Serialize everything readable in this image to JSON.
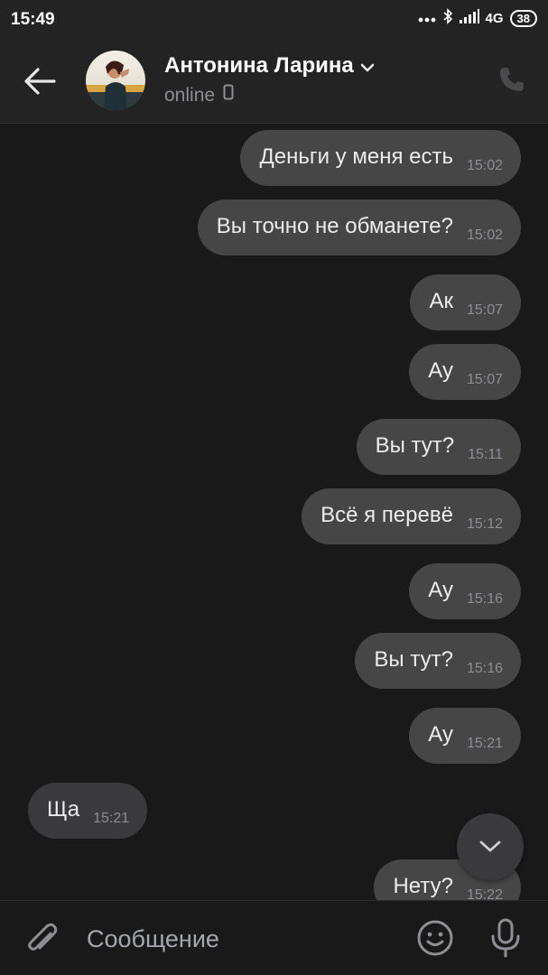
{
  "status_bar": {
    "time": "15:49",
    "network": "4G",
    "battery": "38"
  },
  "header": {
    "contact_name": "Антонина Ларина",
    "status": "online"
  },
  "messages": [
    {
      "text": "Деньги у меня есть",
      "time": "15:02",
      "direction": "out"
    },
    {
      "text": "Вы точно не обманете?",
      "time": "15:02",
      "direction": "out"
    },
    {
      "text": "Ак",
      "time": "15:07",
      "direction": "out"
    },
    {
      "text": "Ау",
      "time": "15:07",
      "direction": "out"
    },
    {
      "text": "Вы тут?",
      "time": "15:11",
      "direction": "out"
    },
    {
      "text": "Всё я перевё",
      "time": "15:12",
      "direction": "out"
    },
    {
      "text": "Ау",
      "time": "15:16",
      "direction": "out"
    },
    {
      "text": "Вы тут?",
      "time": "15:16",
      "direction": "out"
    },
    {
      "text": "Ау",
      "time": "15:21",
      "direction": "out"
    },
    {
      "text": "Ща",
      "time": "15:21",
      "direction": "in"
    },
    {
      "text": "Нету?",
      "time": "15:22",
      "direction": "out"
    }
  ],
  "composer": {
    "placeholder": "Сообщение"
  },
  "colors": {
    "background": "#19191a",
    "header": "#232324",
    "bubble_outgoing": "#464646",
    "bubble_incoming": "#3a3a3c",
    "text": "#ececec",
    "muted": "#8e8e93"
  }
}
